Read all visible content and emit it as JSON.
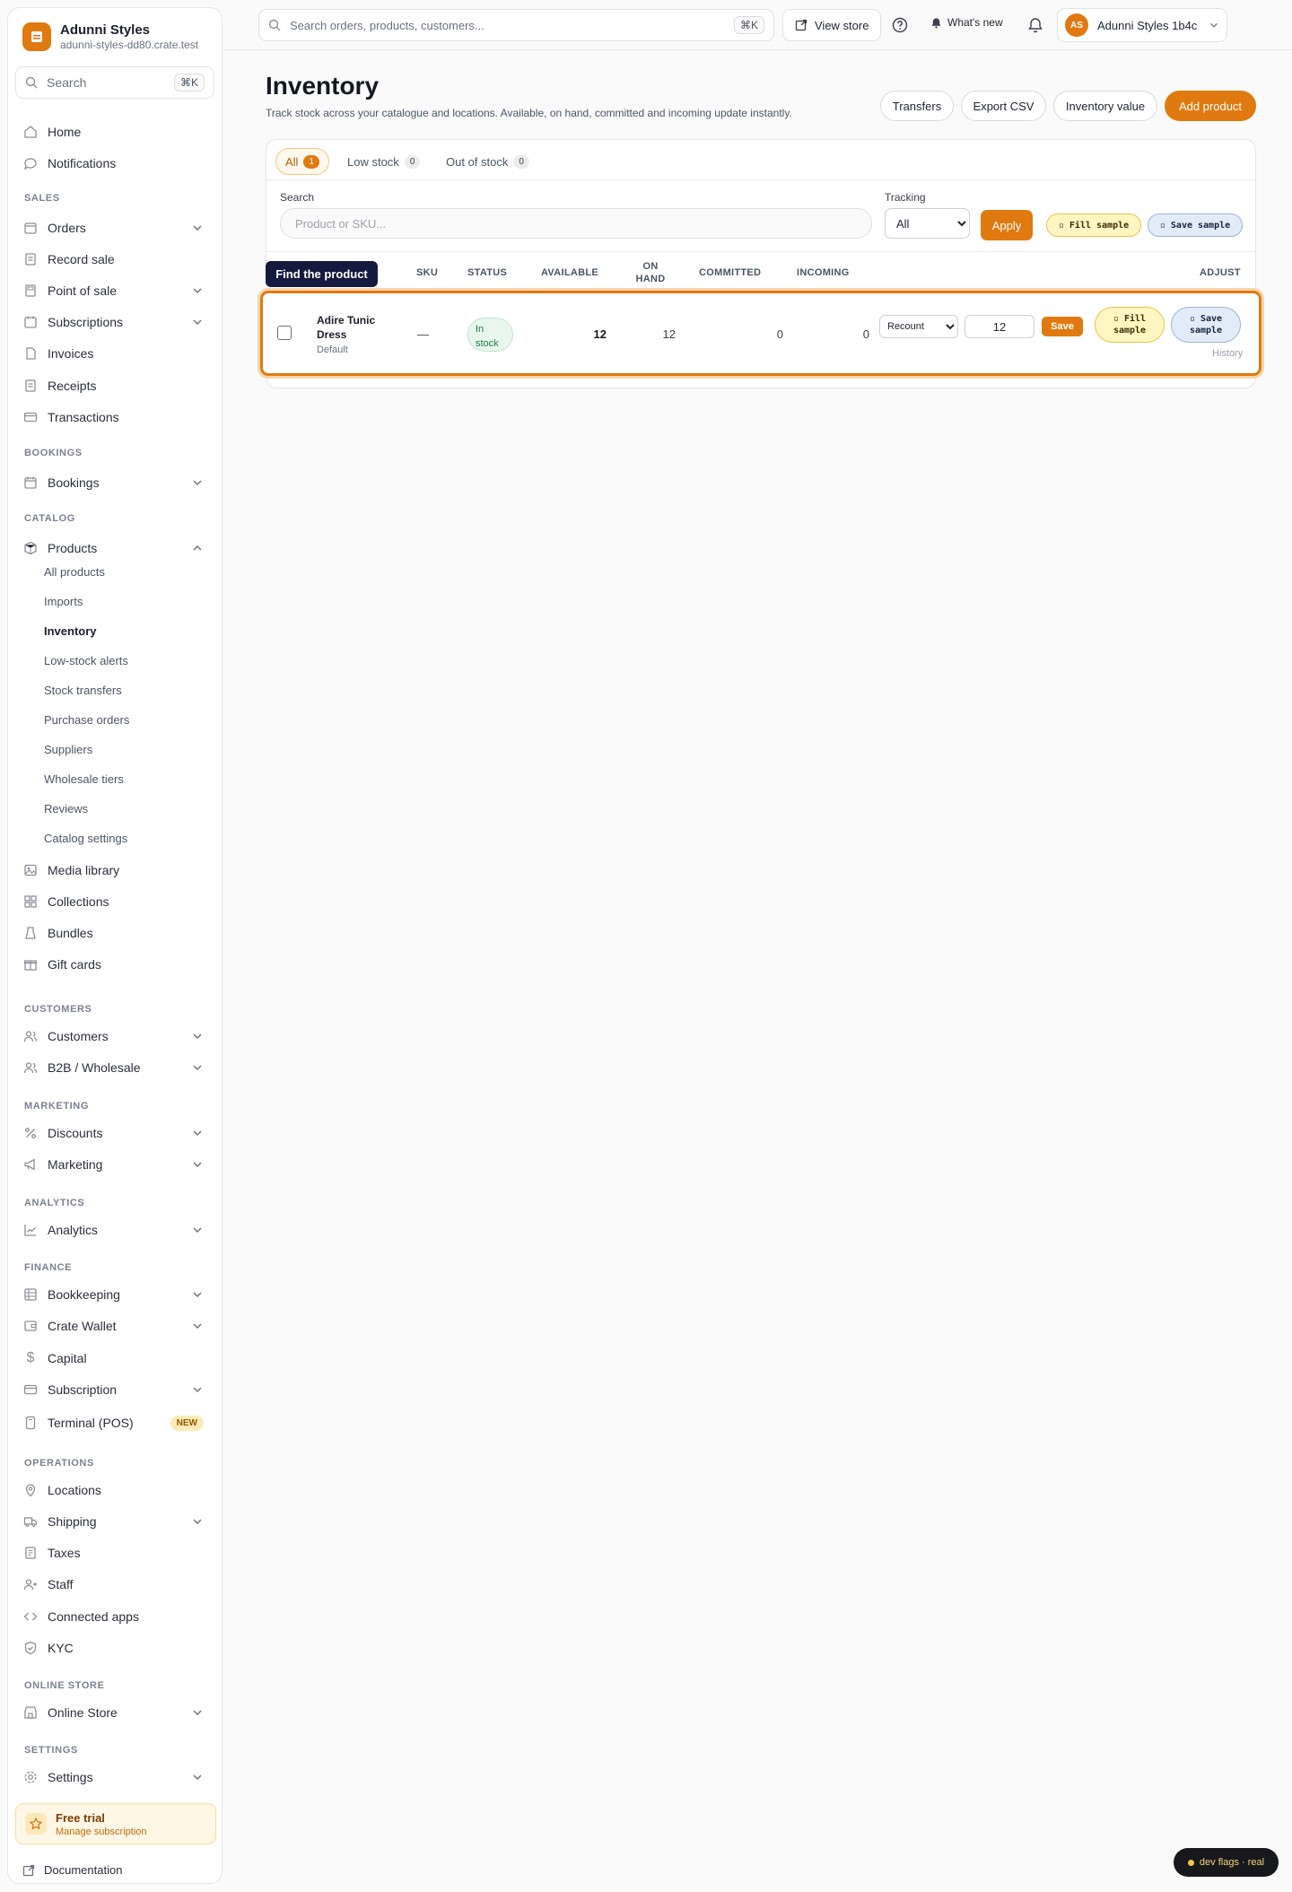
{
  "brand": {
    "name": "Adunni Styles",
    "domain": "adunni-styles-dd80.crate.test"
  },
  "sidebar": {
    "search_label": "Search",
    "search_kbd": "⌘K",
    "items": [
      {
        "label": "Home"
      },
      {
        "label": "Notifications"
      },
      {
        "section": "SALES"
      },
      {
        "label": "Orders"
      },
      {
        "label": "Record sale"
      },
      {
        "label": "Point of sale"
      },
      {
        "label": "Subscriptions"
      },
      {
        "label": "Invoices"
      },
      {
        "label": "Receipts"
      },
      {
        "label": "Transactions"
      },
      {
        "section": "BOOKINGS"
      },
      {
        "label": "Bookings"
      },
      {
        "section": "CATALOG"
      },
      {
        "label": "Products"
      },
      {
        "label": "Media library"
      },
      {
        "label": "Collections"
      },
      {
        "label": "Bundles"
      },
      {
        "label": "Gift cards"
      },
      {
        "section": "CUSTOMERS"
      },
      {
        "label": "Customers"
      },
      {
        "label": "B2B / Wholesale"
      },
      {
        "section": "MARKETING"
      },
      {
        "label": "Discounts"
      },
      {
        "label": "Marketing"
      },
      {
        "section": "ANALYTICS"
      },
      {
        "label": "Analytics"
      },
      {
        "section": "FINANCE"
      },
      {
        "label": "Bookkeeping"
      },
      {
        "label": "Crate Wallet"
      },
      {
        "label": "Capital"
      },
      {
        "label": "Subscription"
      },
      {
        "label": "Terminal (POS)",
        "badge": "NEW"
      },
      {
        "section": "OPERATIONS"
      },
      {
        "label": "Locations"
      },
      {
        "label": "Shipping"
      },
      {
        "label": "Taxes"
      },
      {
        "label": "Staff"
      },
      {
        "label": "Connected apps"
      },
      {
        "label": "KYC"
      },
      {
        "section": "ONLINE STORE"
      },
      {
        "label": "Online Store"
      },
      {
        "section": "SETTINGS"
      },
      {
        "label": "Settings"
      }
    ],
    "products_sub": [
      "All products",
      "Imports",
      "Inventory",
      "Low-stock alerts",
      "Stock transfers",
      "Purchase orders",
      "Suppliers",
      "Wholesale tiers",
      "Reviews",
      "Catalog settings"
    ],
    "active_sub": "Inventory",
    "trial": {
      "title": "Free trial",
      "subtitle": "Manage subscription"
    },
    "docs": "Documentation"
  },
  "topbar": {
    "search_placeholder": "Search orders, products, customers...",
    "search_kbd": "⌘K",
    "view_store": "View store",
    "whats_new": "What's new",
    "avatar_initials": "AS",
    "account_name": "Adunni Styles 1b4c"
  },
  "page": {
    "title": "Inventory",
    "subtitle": "Track stock across your catalogue and locations. Available, on hand, committed and incoming update instantly.",
    "actions": [
      "Transfers",
      "Export CSV",
      "Inventory value",
      "Add product"
    ]
  },
  "tabs": [
    {
      "label": "All",
      "count": "1"
    },
    {
      "label": "Low stock",
      "count": "0"
    },
    {
      "label": "Out of stock",
      "count": "0"
    }
  ],
  "filters": {
    "search_label": "Search",
    "search_placeholder": "Product or SKU...",
    "tracking_label": "Tracking",
    "tracking_value": "All",
    "apply": "Apply",
    "fill_sample": "▫ Fill sample",
    "save_sample": "▫ Save sample"
  },
  "table": {
    "tooltip": "Find the product",
    "headers": {
      "sku": "SKU",
      "status": "STATUS",
      "available": "AVAILABLE",
      "on_hand": "ON HAND",
      "committed": "COMMITTED",
      "incoming": "INCOMING",
      "adjust": "ADJUST"
    },
    "row": {
      "name": "Adire Tunic Dress",
      "variant": "Default",
      "sku": "—",
      "status": "In stock",
      "available": "12",
      "on_hand": "12",
      "committed": "0",
      "incoming": "0",
      "adjust_mode": "Recount",
      "adjust_value": "12",
      "save": "Save",
      "fill_sample": "▫ Fill sample",
      "save_sample": "▫ Save sample",
      "history": "History"
    }
  },
  "devflags": "dev flags · real",
  "colors": {
    "accent": "#e07a10",
    "tooltip_bg": "#141a3d",
    "status_green": "#1b7a45"
  }
}
